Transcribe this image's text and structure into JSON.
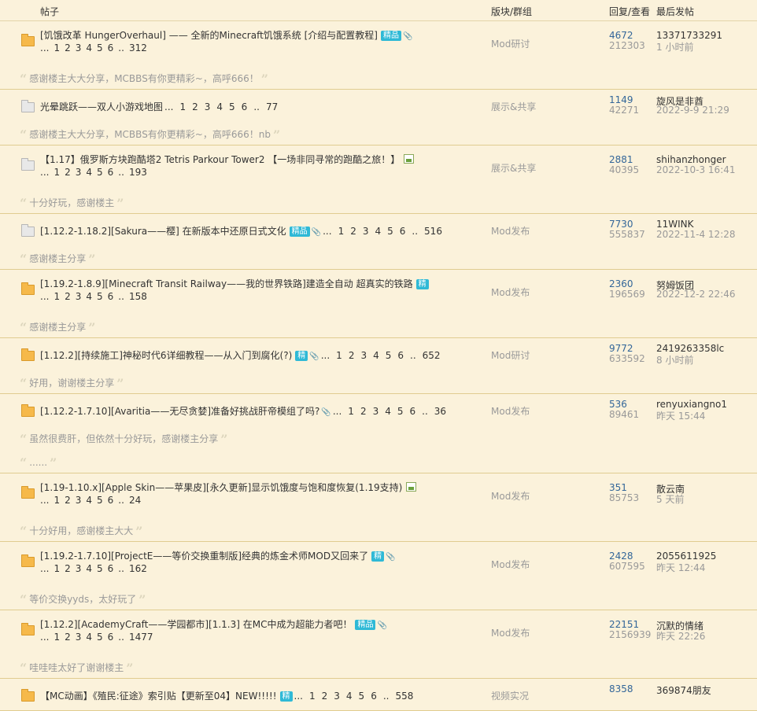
{
  "header": {
    "col_title": "帖子",
    "col_forum": "版块/群组",
    "col_replies": "回复/查看",
    "col_last": "最后发帖"
  },
  "icons": {
    "clip": "📎",
    "quote_open": "“",
    "quote_close": "”"
  },
  "colors": {
    "background": "#fbf2db",
    "badge": "#2fb9d6",
    "reply_count": "#336699",
    "folder_new": "#f6b94a"
  },
  "threads": [
    {
      "title": "[饥饿改革 HungerOverhaul] —— 全新的Minecraft饥饿系统 [介绍与配置教程]",
      "badge": "精品",
      "clip": true,
      "image": false,
      "pages": [
        "...",
        "1",
        "2",
        "3",
        "4",
        "5",
        "6",
        "..",
        "312"
      ],
      "pages_inline": false,
      "forum": "Mod研讨",
      "replies": "4672",
      "views": "212303",
      "last_user": "13371733291",
      "last_time": "1 小时前",
      "reply_text": "感谢楼主大大分享，MCBBS有你更精彩~，高呼666！",
      "folder": "new"
    },
    {
      "title": "光晕跳跃——双人小游戏地图",
      "badge": "",
      "clip": false,
      "image": false,
      "pages": [
        "...",
        "1",
        "2",
        "3",
        "4",
        "5",
        "6",
        "..",
        "77"
      ],
      "pages_inline": true,
      "forum": "展示&共享",
      "replies": "1149",
      "views": "42271",
      "last_user": "旋风是非酋",
      "last_time": "2022-9-9 21:29",
      "reply_text": "感谢楼主大大分享，MCBBS有你更精彩~，高呼666！nb",
      "folder": "read"
    },
    {
      "title": "【1.17】俄罗斯方块跑酷塔2 Tetris Parkour Tower2 【一场非同寻常的跑酷之旅！】",
      "badge": "",
      "clip": false,
      "image": true,
      "pages": [
        "...",
        "1",
        "2",
        "3",
        "4",
        "5",
        "6",
        "..",
        "193"
      ],
      "pages_inline": false,
      "forum": "展示&共享",
      "replies": "2881",
      "views": "40395",
      "last_user": "shihanzhonger",
      "last_time": "2022-10-3 16:41",
      "reply_text": "十分好玩，感谢楼主",
      "folder": "read"
    },
    {
      "title": "[1.12.2-1.18.2][Sakura——樱] 在新版本中还原日式文化",
      "badge": "精品",
      "clip": true,
      "image": false,
      "pages": [
        "...",
        "1",
        "2",
        "3",
        "4",
        "5",
        "6",
        "..",
        "516"
      ],
      "pages_inline": true,
      "forum": "Mod发布",
      "replies": "7730",
      "views": "555837",
      "last_user": "11WINK",
      "last_time": "2022-11-4 12:28",
      "reply_text": "感谢楼主分享",
      "folder": "read"
    },
    {
      "title": "[1.19.2-1.8.9][Minecraft Transit Railway——我的世界铁路]建造全自动 超真实的铁路",
      "badge": "精",
      "clip": false,
      "image": false,
      "pages": [
        "...",
        "1",
        "2",
        "3",
        "4",
        "5",
        "6",
        "..",
        "158"
      ],
      "pages_inline": false,
      "forum": "Mod发布",
      "replies": "2360",
      "views": "196569",
      "last_user": "努姆饭团",
      "last_time": "2022-12-2 22:46",
      "reply_text": "感谢楼主分享",
      "folder": "new"
    },
    {
      "title": "[1.12.2][持续施工]神秘时代6详细教程——从入门到腐化(?)",
      "badge": "精",
      "clip": true,
      "image": false,
      "pages": [
        "...",
        "1",
        "2",
        "3",
        "4",
        "5",
        "6",
        "..",
        "652"
      ],
      "pages_inline": true,
      "forum": "Mod研讨",
      "replies": "9772",
      "views": "633592",
      "last_user": "2419263358lc",
      "last_time": "8 小时前",
      "reply_text": "好用，谢谢楼主分享",
      "folder": "new"
    },
    {
      "title": "[1.12.2-1.7.10][Avaritia——无尽贪婪]准备好挑战肝帝模组了吗?",
      "badge": "",
      "clip": true,
      "image": false,
      "pages": [
        "...",
        "1",
        "2",
        "3",
        "4",
        "5",
        "6",
        "..",
        "36"
      ],
      "pages_inline": true,
      "forum": "Mod发布",
      "replies": "536",
      "views": "89461",
      "last_user": "renyuxiangno1",
      "last_time": "昨天 15:44",
      "reply_text": "虽然很费肝，但依然十分好玩，感谢楼主分享",
      "reply_text_2": "......",
      "folder": "new"
    },
    {
      "title": "[1.19-1.10.x][Apple Skin——苹果皮][永久更新]显示饥饿度与饱和度恢复(1.19支持)",
      "badge": "",
      "clip": false,
      "image": true,
      "pages": [
        "...",
        "1",
        "2",
        "3",
        "4",
        "5",
        "6",
        "..",
        "24"
      ],
      "pages_inline": false,
      "forum": "Mod发布",
      "replies": "351",
      "views": "85753",
      "last_user": "散云南",
      "last_time": "5 天前",
      "reply_text": "十分好用，感谢楼主大大",
      "folder": "new"
    },
    {
      "title": "[1.19.2-1.7.10][ProjectE——等价交换重制版]经典的炼金术师MOD又回来了",
      "badge": "精",
      "clip": true,
      "image": false,
      "pages": [
        "...",
        "1",
        "2",
        "3",
        "4",
        "5",
        "6",
        "..",
        "162"
      ],
      "pages_inline": false,
      "forum": "Mod发布",
      "replies": "2428",
      "views": "607595",
      "last_user": "2055611925",
      "last_time": "昨天 12:44",
      "reply_text": "等价交换yyds，太好玩了",
      "folder": "new"
    },
    {
      "title": "[1.12.2][AcademyCraft——学园都市][1.1.3] 在MC中成为超能力者吧！",
      "badge": "精品",
      "clip": true,
      "image": false,
      "pages": [
        "...",
        "1",
        "2",
        "3",
        "4",
        "5",
        "6",
        "..",
        "1477"
      ],
      "pages_inline": false,
      "forum": "Mod发布",
      "replies": "22151",
      "views": "2156939",
      "last_user": "沉默的情绪",
      "last_time": "昨天 22:26",
      "reply_text": "哇哇哇太好了谢谢楼主",
      "folder": "new"
    },
    {
      "title": "【MC动画】《殖民:征途》索引贴【更新至04】NEW!!!!!",
      "badge": "精",
      "clip": false,
      "image": false,
      "pages": [
        "...",
        "1",
        "2",
        "3",
        "4",
        "5",
        "6",
        "..",
        "558"
      ],
      "pages_inline": true,
      "forum": "视频实况",
      "replies": "8358",
      "views": "",
      "last_user": "369874朋友",
      "last_time": "",
      "reply_text": "",
      "folder": "new"
    }
  ]
}
